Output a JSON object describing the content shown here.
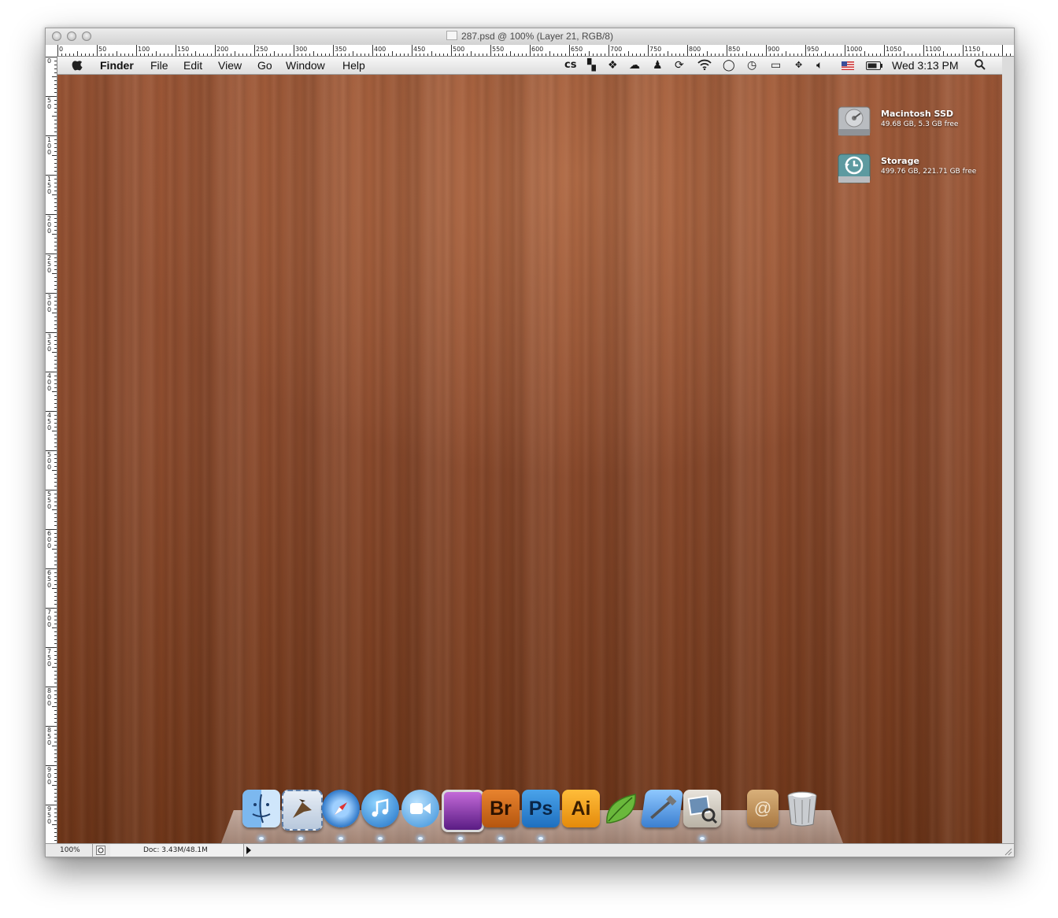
{
  "window": {
    "title": "287.psd @ 100% (Layer 21, RGB/8)"
  },
  "ruler": {
    "top_ticks": [
      "0",
      "50",
      "100",
      "150",
      "200",
      "250",
      "300",
      "350",
      "400",
      "450",
      "500",
      "550",
      "600",
      "650",
      "700",
      "750",
      "800",
      "850",
      "900",
      "950",
      "1000",
      "1050",
      "1100",
      "1150"
    ],
    "left_ticks": [
      "0",
      "5\n0",
      "1\n0\n0",
      "1\n5\n0",
      "2\n0\n0",
      "2\n5\n0",
      "3\n0\n0",
      "3\n5\n0",
      "4\n0\n0",
      "4\n5\n0",
      "5\n0\n0",
      "5\n5\n0",
      "6\n0\n0",
      "6\n5\n0",
      "7\n0\n0",
      "7\n5\n0",
      "8\n0\n0",
      "8\n5\n0",
      "9\n0\n0",
      "9\n5\n0"
    ]
  },
  "menubar": {
    "apple": "",
    "app_name": "Finder",
    "items": [
      "File",
      "Edit",
      "View",
      "Go",
      "Window",
      "Help"
    ],
    "status_icons": [
      "lastfm-icon",
      "notes-icon",
      "dropbox-icon",
      "cloud-icon",
      "user-icon",
      "sync-icon",
      "wifi-icon",
      "chat-icon",
      "time-machine-icon",
      "display-icon",
      "move-icon",
      "volume-icon",
      "flag-us-icon",
      "battery-icon"
    ],
    "clock": "Wed 3:13 PM",
    "search_icon": "spotlight-icon"
  },
  "desktop": {
    "drives": [
      {
        "name": "Macintosh SSD",
        "info": "49.68 GB, 5.3 GB free",
        "icon": "hard-drive-icon"
      },
      {
        "name": "Storage",
        "info": "499.76 GB, 221.71 GB free",
        "icon": "time-machine-drive-icon"
      }
    ]
  },
  "dock": {
    "apps": [
      {
        "name": "finder-icon",
        "label": ""
      },
      {
        "name": "mail-icon",
        "label": ""
      },
      {
        "name": "safari-icon",
        "label": ""
      },
      {
        "name": "itunes-icon",
        "label": ""
      },
      {
        "name": "facetime-icon",
        "label": ""
      },
      {
        "name": "purple-app-icon",
        "label": ""
      },
      {
        "name": "bridge-icon",
        "label": "Br"
      },
      {
        "name": "photoshop-icon",
        "label": "Ps"
      },
      {
        "name": "illustrator-icon",
        "label": "Ai"
      },
      {
        "name": "coda-icon",
        "label": ""
      },
      {
        "name": "xcode-icon",
        "label": ""
      },
      {
        "name": "preview-icon",
        "label": ""
      },
      {
        "name": "address-book-icon",
        "label": ""
      },
      {
        "name": "trash-icon",
        "label": ""
      }
    ]
  },
  "statusbar": {
    "zoom": "100%",
    "doc": "Doc: 3.43M/48.1M"
  },
  "colors": {
    "wood_light": "#b06a45",
    "wood_dark": "#6f3619",
    "bridge": "#d9701c",
    "photoshop": "#2d8ad6",
    "illustrator": "#f2a21b"
  }
}
